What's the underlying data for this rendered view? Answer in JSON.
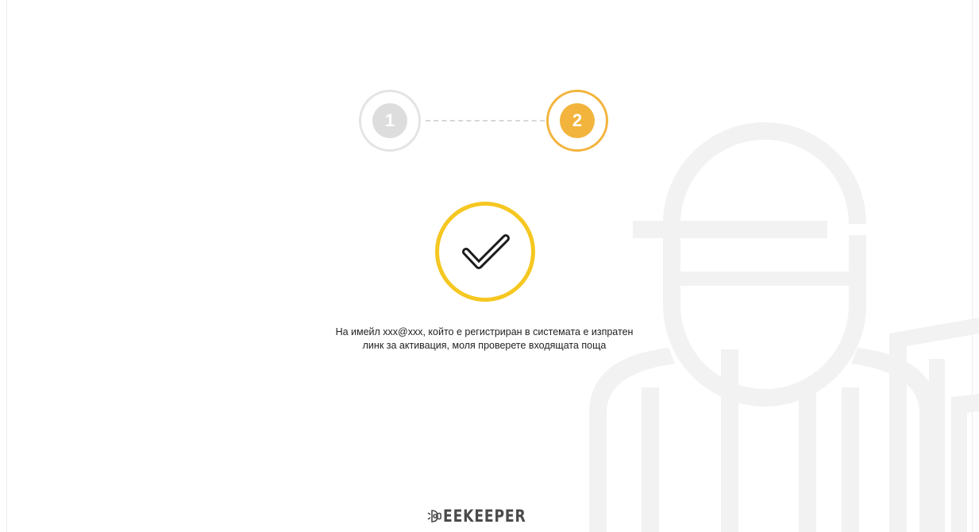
{
  "stepper": {
    "steps": [
      {
        "label": "1",
        "state": "completed"
      },
      {
        "label": "2",
        "state": "active"
      }
    ]
  },
  "success": {
    "icon": "checkmark-icon",
    "message_line_1": "На имейл xxx@xxx, който е регистриран в системата е изпратен",
    "message_line_2": "линк за активация, моля проверете входящата поща"
  },
  "brand": {
    "icon": "bee-icon",
    "name": "EEKEEPER"
  },
  "colors": {
    "accent": "#f2b43d",
    "success_ring": "#f5c720",
    "inactive": "#dddddd",
    "text": "#222222",
    "background_art": "#f2f2f2"
  }
}
